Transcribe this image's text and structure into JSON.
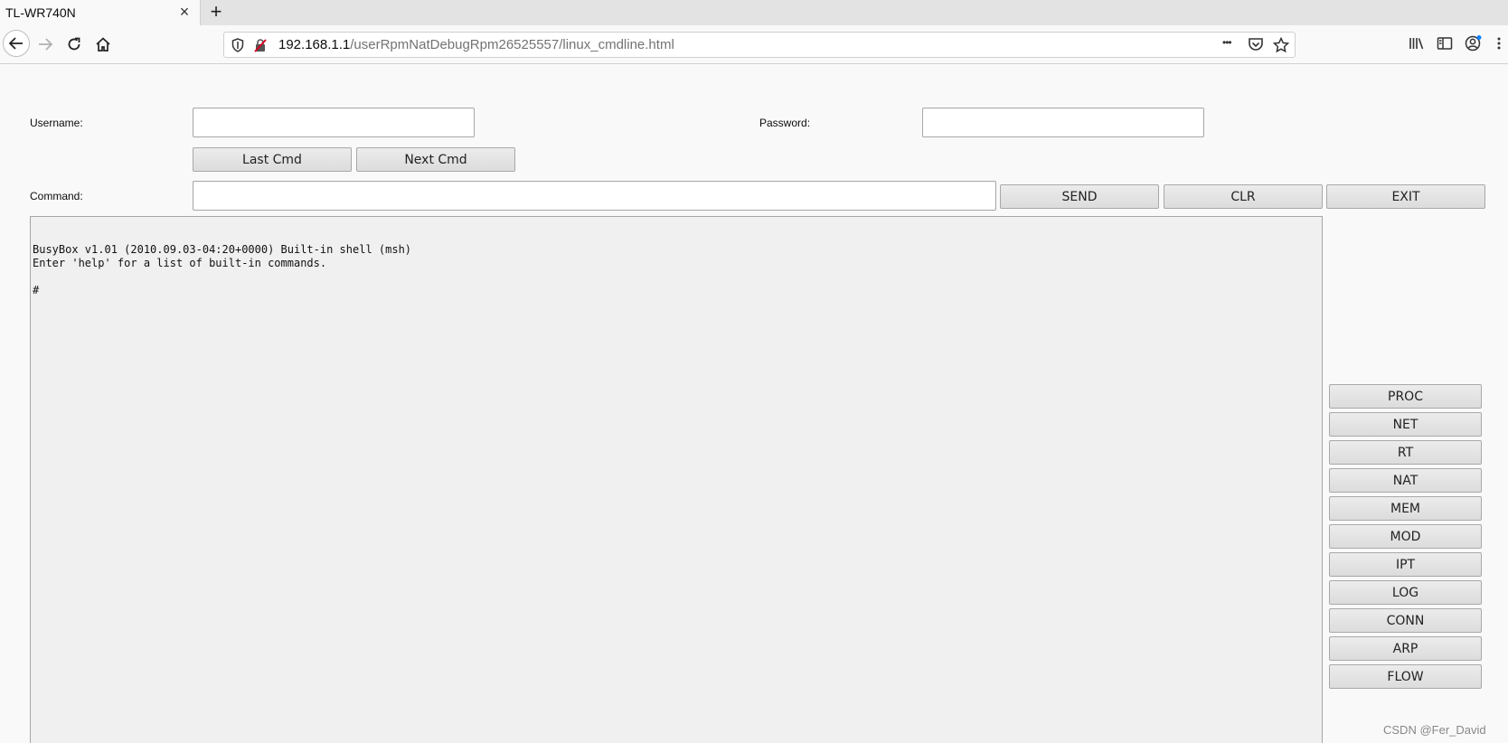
{
  "browser": {
    "tab_title": "TL-WR740N",
    "tab_close_glyph": "×",
    "new_tab_glyph": "+",
    "url_host": "192.168.1.1",
    "url_path": "/userRpmNatDebugRpm26525557/linux_cmdline.html",
    "page_actions_glyph": "•••",
    "icons": [
      "back-icon",
      "forward-icon",
      "reload-icon",
      "home-icon",
      "shield-icon",
      "insecure-lock-icon",
      "page-actions-icon",
      "pocket-icon",
      "bookmark-star-icon",
      "library-icon",
      "sidebar-icon",
      "account-icon",
      "menu-icon"
    ]
  },
  "form": {
    "username_label": "Username:",
    "username_value": "",
    "password_label": "Password:",
    "password_value": "",
    "command_label": "Command:",
    "command_value": "",
    "last_cmd_label": "Last Cmd",
    "next_cmd_label": "Next Cmd",
    "send_label": "SEND",
    "clr_label": "CLR",
    "exit_label": "EXIT"
  },
  "console": {
    "output": "BusyBox v1.01 (2010.09.03-04:20+0000) Built-in shell (msh)\nEnter 'help' for a list of built-in commands.\n\n#"
  },
  "side_buttons": [
    "PROC",
    "NET",
    "RT",
    "NAT",
    "MEM",
    "MOD",
    "IPT",
    "LOG",
    "CONN",
    "ARP",
    "FLOW"
  ],
  "watermark": "CSDN @Fer_David"
}
